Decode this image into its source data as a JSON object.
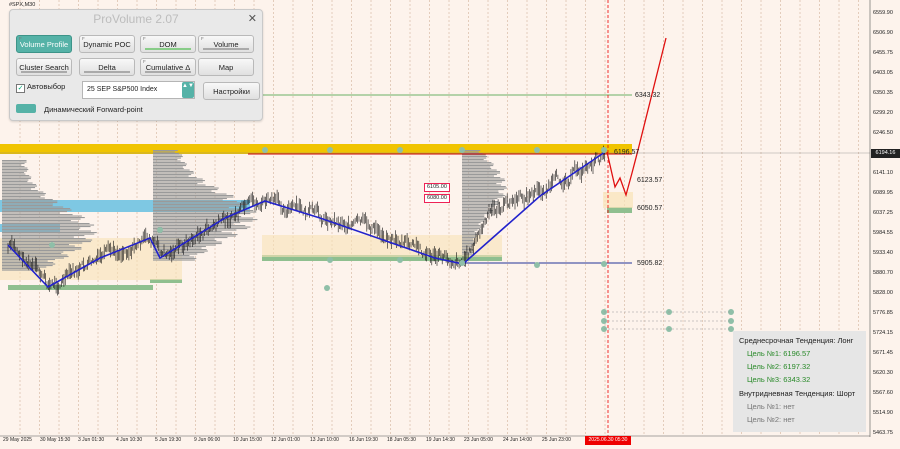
{
  "chart_symbol": "#SPX,M30",
  "panel": {
    "title": "ProVolume 2.07",
    "close": "✕",
    "buttons": [
      {
        "label": "Volume Profile",
        "key": "F",
        "active": true
      },
      {
        "label": "Dynamic POC",
        "key": "F",
        "active": false
      },
      {
        "label": "DOM",
        "key": "F",
        "active": false
      },
      {
        "label": "Volume",
        "key": "F",
        "active": false
      },
      {
        "label": "Cluster Search",
        "key": "",
        "active": false
      },
      {
        "label": "Delta",
        "key": "",
        "active": false
      },
      {
        "label": "Cumulative Δ",
        "key": "F",
        "active": false
      },
      {
        "label": "Map",
        "key": "",
        "active": false
      }
    ],
    "auto_label": "Автовыбор",
    "auto_checked": "✓",
    "symbol_value": "25 SEP S&P500 Index",
    "symbol_btn": "▲▼",
    "settings_label": "Настройки",
    "forward_label": "Динамический Forward-point"
  },
  "trend": {
    "mid_title": "Среднесрочная Тенденция: Лонг",
    "mid_targets": [
      "Цель №1: 6196.57",
      "Цель №2: 6197.32",
      "Цель №3: 6343.32"
    ],
    "intra_title": "Внутридневная Тенденция: Шорт",
    "intra_targets": [
      "Цель №1: нет",
      "Цель №2: нет"
    ]
  },
  "y_axis": [
    "6559.90",
    "6506.90",
    "6455.75",
    "6403.05",
    "6350.35",
    "6299.20",
    "6246.50",
    "6194.16",
    "6141.10",
    "6089.95",
    "6037.25",
    "5984.55",
    "5933.40",
    "5880.70",
    "5828.00",
    "5776.85",
    "5724.15",
    "5671.45",
    "5620.30",
    "5567.60",
    "5514.90",
    "5463.75"
  ],
  "current_price": "6194.16",
  "x_axis": [
    "29 May 2025",
    "30 May 15:30",
    "3 Jun 01:30",
    "4 Jun 10:30",
    "5 Jun 19:30",
    "9 Jun 06:00",
    "10 Jun 15:00",
    "12 Jun 01:00",
    "13 Jun 10:00",
    "16 Jun 19:30",
    "18 Jun 05:30",
    "19 Jun 14:30",
    "23 Jun 05:00",
    "24 Jun 14:00",
    "25 Jun 23:00",
    "2025.06.30 05:30"
  ],
  "chart_labels": {
    "lvl_6343": "6343.32",
    "lvl_6196": "6196.57",
    "lvl_6123": "6123.57",
    "lvl_6050": "6050.57",
    "lvl_5905": "5905.82",
    "box_6105": "6105.00",
    "box_6080": "6080.00"
  },
  "colors": {
    "background": "#fdf3ec",
    "accent": "#55b2a7",
    "candles": "#111111",
    "zigzag": "#2222cc",
    "forecast": "#e01010",
    "level_gold": "#f0c400",
    "level_cyan": "#7ec8e3",
    "level_green": "#8fbf8f",
    "volume_profile": "#9a9a9a"
  }
}
